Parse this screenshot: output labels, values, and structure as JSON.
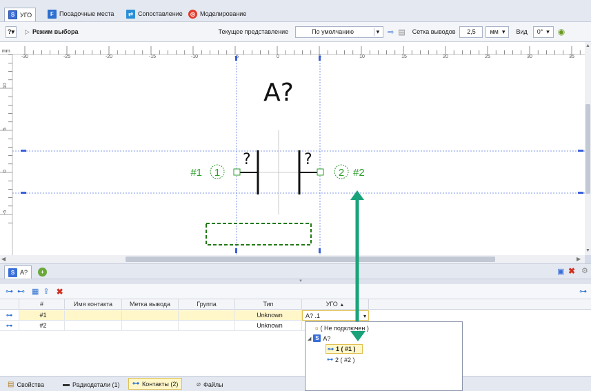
{
  "tabs": [
    {
      "label": "УГО",
      "icon": "ugo-icon"
    },
    {
      "label": "Посадочные места",
      "icon": "footprint-icon"
    },
    {
      "label": "Сопоставление",
      "icon": "mapping-icon"
    },
    {
      "label": "Моделирование",
      "icon": "simulation-icon"
    }
  ],
  "toolbar": {
    "mode_label": "Режим выбора",
    "view_label": "Текущее представление",
    "view_value": "По умолчанию",
    "grid_label": "Сетка выводов",
    "grid_value": "2,5",
    "unit_value": "мм",
    "vid_label": "Вид",
    "rotation_value": "0°"
  },
  "canvas": {
    "ruler_unit": "mm",
    "ruler_ticks": [
      "-30",
      "-25",
      "-20",
      "-15",
      "-10",
      "-5",
      "0",
      "5",
      "10",
      "15",
      "20",
      "25",
      "30",
      "35"
    ],
    "vruler_ticks": [
      "10",
      "5",
      "0",
      "-5"
    ],
    "refdes": "A?",
    "pin_left_name": "#1",
    "pin_left_num": "1",
    "pin_right_name": "#2",
    "pin_right_num": "2",
    "pin_q_left": "?",
    "pin_q_right": "?",
    "accent_color": "#2e9e2e",
    "guide_color": "#3a5fd9",
    "arrow_color": "#1aa37a"
  },
  "lower_tabs": {
    "tab1": "A?"
  },
  "grid": {
    "columns": [
      "#",
      "Имя контакта",
      "Метка вывода",
      "Группа",
      "Тип",
      "УГО"
    ],
    "rows": [
      {
        "num": "#1",
        "name": "",
        "label": "",
        "group": "",
        "type": "Unknown",
        "ugo": "A? .1"
      },
      {
        "num": "#2",
        "name": "",
        "label": "",
        "group": "",
        "type": "Unknown",
        "ugo": ""
      }
    ]
  },
  "dropdown": {
    "not_connected": "( Не подключен )",
    "group": "A?",
    "items": [
      "1 ( #1 )",
      "2 ( #2 )"
    ]
  },
  "bottom_tabs": [
    {
      "label": "Свойства",
      "icon": "properties-icon"
    },
    {
      "label": "Радиодетали (1)",
      "icon": "components-icon"
    },
    {
      "label": "Контакты (2)",
      "icon": "pin-icon"
    },
    {
      "label": "Файлы",
      "icon": "files-icon"
    }
  ]
}
